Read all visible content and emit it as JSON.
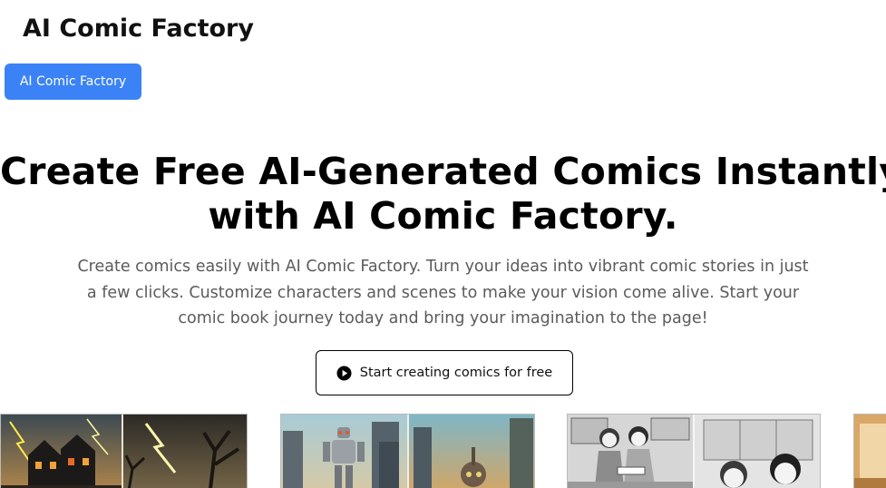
{
  "header": {
    "site_title": "AI Comic Factory",
    "nav_button_label": "AI Comic Factory"
  },
  "hero": {
    "title_line1": "Create Free AI-Generated Comics Instantly",
    "title_line2": "with AI Comic Factory.",
    "description_lines": [
      "Create comics easily with AI Comic Factory. Turn your ideas into vibrant comic stories in just",
      "a few clicks. Customize characters and scenes to make your vision come alive. Start your",
      "comic book journey today and bring your imagination to the page!"
    ],
    "cta_label": "Start creating comics for free",
    "cta_icon": "play-circle-icon"
  },
  "gallery": {
    "items": [
      {
        "subject": "haunted-house-lightning-comic"
      },
      {
        "subject": "robot-city-comic"
      },
      {
        "subject": "manga-girls-reading-comic"
      },
      {
        "subject": "partial-comic"
      }
    ]
  },
  "colors": {
    "accent": "#3b82f6",
    "text_muted": "#5b5b5b"
  }
}
